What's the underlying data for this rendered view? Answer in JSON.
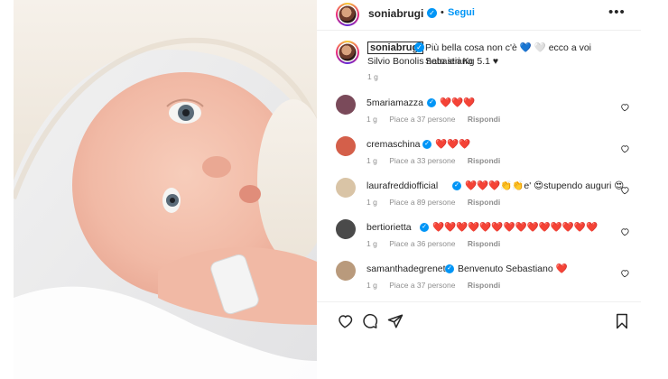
{
  "header": {
    "username": "soniabrugi",
    "separator": "•",
    "follow_label": "Segui",
    "more_label": "•••"
  },
  "caption": {
    "username": "soniabrugi",
    "text_line1": "Più bella cosa non c'è 💙 🤍 ecco a voi Sebastiano",
    "text_line2": "Silvio Bonolis nato ieri Kg 5.1 ♥",
    "time": "1 g"
  },
  "comments": [
    {
      "username": "5mariamazza",
      "text": "❤️❤️❤️",
      "time": "1 g",
      "likes": "Piace a 37 persone",
      "reply": "Rispondi",
      "avatar_color": "#7a4a5a"
    },
    {
      "username": "cremaschina",
      "text": "❤️❤️❤️",
      "time": "1 g",
      "likes": "Piace a 33 persone",
      "reply": "Rispondi",
      "avatar_color": "#d45f4a"
    },
    {
      "username": "laurafreddiofficial",
      "text": "❤️❤️❤️👏👏e' 😍stupendo auguri 😍",
      "time": "1 g",
      "likes": "Piace a 89 persone",
      "reply": "Rispondi",
      "avatar_color": "#d9c4a6"
    },
    {
      "username": "bertiorietta",
      "text": "❤️❤️❤️❤️❤️❤️❤️❤️❤️❤️❤️❤️❤️❤️",
      "time": "1 g",
      "likes": "Piace a 36 persone",
      "reply": "Rispondi",
      "avatar_color": "#4a4a4a"
    },
    {
      "username": "samanthadegrenet",
      "text": "Benvenuto Sebastiano ❤️",
      "time": "1 g",
      "likes": "Piace a 37 persone",
      "reply": "Rispondi",
      "avatar_color": "#b99a7c"
    }
  ],
  "colors": {
    "accent": "#0095f6",
    "text": "#262626",
    "muted": "#8e8e8e",
    "heart": "#ed4956"
  }
}
